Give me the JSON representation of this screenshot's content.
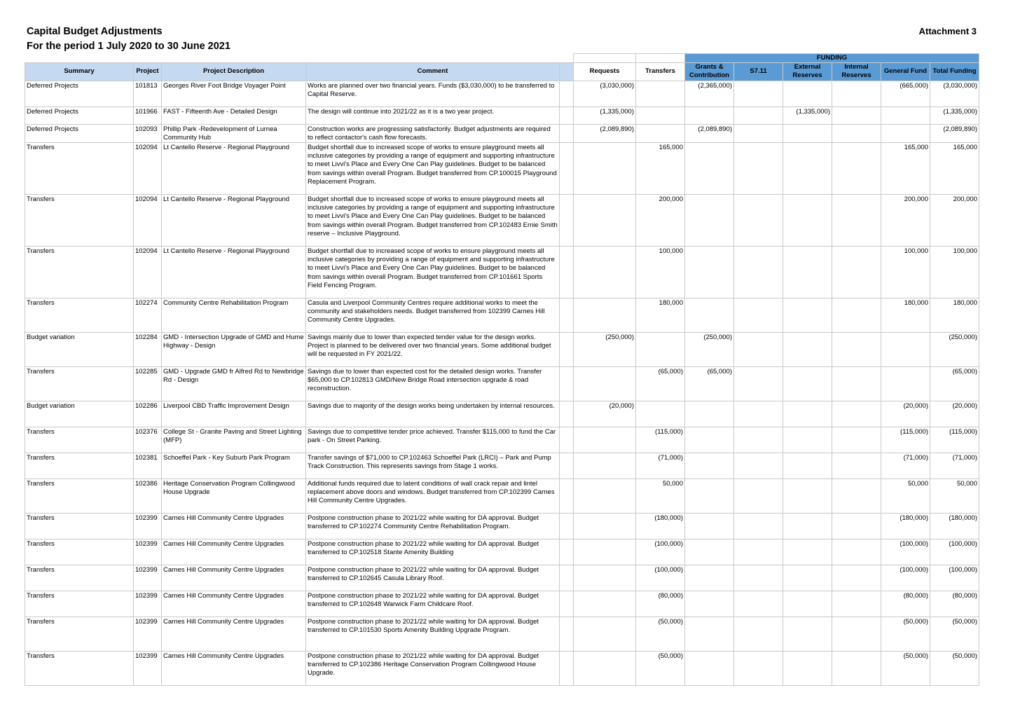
{
  "header": {
    "title": "Capital Budget Adjustments",
    "period": "For the period 1 July 2020 to 30 June 2021",
    "attachment": "Attachment 3"
  },
  "columns": {
    "summary": "Summary",
    "project": "Project",
    "description": "Project Description",
    "comment": "Comment",
    "requests": "Requests",
    "transfers": "Transfers",
    "funding": "FUNDING",
    "grants": "Grants & Contribution",
    "s711": "S7.11",
    "external": "External Reserves",
    "internal": "Internal Reserves",
    "general": "General Fund",
    "total": "Total Funding"
  },
  "rows": [
    {
      "summary": "Deferred Projects",
      "project": "101813",
      "description": "Georges River Foot Bridge Voyager Point",
      "comment": "Works are planned over two financial years. Funds ($3,030,000) to be transferred to Capital Reserve.",
      "requests": "(3,030,000)",
      "transfers": "",
      "grants": "(2,365,000)",
      "s711": "",
      "external": "",
      "internal": "",
      "general": "(665,000)",
      "total": "(3,030,000)",
      "h": 37
    },
    {
      "summary": "Deferred Projects",
      "project": "101966",
      "description": "FAST - Fifteenth Ave - Detailed Design",
      "comment": "The design will continue into 2021/22 as it is a two year project.",
      "requests": "(1,335,000)",
      "transfers": "",
      "grants": "",
      "s711": "",
      "external": "(1,335,000)",
      "internal": "",
      "general": "",
      "total": "(1,335,000)",
      "h": 25
    },
    {
      "summary": "Deferred Projects",
      "project": "102093",
      "description": "Phillip Park -Redevelopment of Lurnea Community Hub",
      "comment": "Construction works are progressing satisfactorily. Budget adjustments are required to reflect contactor's cash flow forecasts.",
      "requests": "(2,089,890)",
      "transfers": "",
      "grants": "(2,089,890)",
      "s711": "",
      "external": "",
      "internal": "",
      "general": "",
      "total": "(2,089,890)",
      "h": 26
    },
    {
      "summary": "Transfers",
      "project": "102094",
      "description": "Lt Cantello Reserve - Regional Playground",
      "comment": "Budget shortfall due to increased scope of works to ensure playground meets all inclusive categories by providing a range of equipment and supporting infrastructure to meet Livvi's Place and Every One Can Play guidelines.  Budget to be balanced from savings within overall Program.  Budget transferred from CP.100015 Playground Replacement Program.",
      "requests": "",
      "transfers": "165,000",
      "grants": "",
      "s711": "",
      "external": "",
      "internal": "",
      "general": "165,000",
      "total": "165,000",
      "h": 74
    },
    {
      "summary": "Transfers",
      "project": "102094",
      "description": "Lt Cantello Reserve - Regional Playground",
      "comment": "Budget shortfall due to increased scope of works to ensure playground meets all inclusive categories by providing a range of equipment and supporting infrastructure to meet Livvi's Place and Every One Can Play guidelines.  Budget to be balanced from savings within overall Program.  Budget transferred from CP.102483 Ernie Smith reserve – Inclusive Playground.",
      "requests": "",
      "transfers": "200,000",
      "grants": "",
      "s711": "",
      "external": "",
      "internal": "",
      "general": "200,000",
      "total": "200,000",
      "h": 74
    },
    {
      "summary": "Transfers",
      "project": "102094",
      "description": "Lt Cantello Reserve - Regional Playground",
      "comment": "Budget shortfall due to increased scope of works to ensure playground meets all inclusive categories by providing a range of equipment and supporting infrastructure to meet Livvi's Place and Every One Can Play guidelines.  Budget to be balanced from savings within overall Program.  Budget transferred from CP.101661 Sports Field Fencing Program.",
      "requests": "",
      "transfers": "100,000",
      "grants": "",
      "s711": "",
      "external": "",
      "internal": "",
      "general": "100,000",
      "total": "100,000",
      "h": 74
    },
    {
      "summary": "Transfers",
      "project": "102274",
      "description": "Community Centre Rehabilitation Program",
      "comment": "Casula and Liverpool Community Centres require additional works to meet the community and stakeholders needs.  Budget transferred from 102399 Carnes Hill Community Centre Upgrades.",
      "requests": "",
      "transfers": "180,000",
      "grants": "",
      "s711": "",
      "external": "",
      "internal": "",
      "general": "180,000",
      "total": "180,000",
      "h": 49
    },
    {
      "summary": "Budget variation",
      "project": "102284",
      "description": "GMD - Intersection Upgrade of GMD and Hume Highway - Design",
      "comment": "Savings mainly due to lower than expected tender value for the design works. Project is planned to be delivered over two financial years. Some additional budget will be requested in FY 2021/22.",
      "requests": "(250,000)",
      "transfers": "",
      "grants": "(250,000)",
      "s711": "",
      "external": "",
      "internal": "",
      "general": "",
      "total": "(250,000)",
      "h": 49
    },
    {
      "summary": "Transfers",
      "project": "102285",
      "description": "GMD - Upgrade GMD fr Alfred Rd to Newbridge Rd - Design",
      "comment": "Savings due to lower than expected cost for the detailed design works. Transfer $65,000 to CP.102813 GMD/New Bridge Road intersection upgrade & road reconstruction.",
      "requests": "",
      "transfers": "(65,000)",
      "grants": "(65,000)",
      "s711": "",
      "external": "",
      "internal": "",
      "general": "",
      "total": "(65,000)",
      "h": 49
    },
    {
      "summary": "Budget variation",
      "project": "102286",
      "description": "Liverpool CBD Traffic Improvement Design",
      "comment": "Savings due to majority of the design works being undertaken by internal resources.",
      "requests": "(20,000)",
      "transfers": "",
      "grants": "",
      "s711": "",
      "external": "",
      "internal": "",
      "general": "(20,000)",
      "total": "(20,000)",
      "h": 37
    },
    {
      "summary": "Transfers",
      "project": "102376",
      "description": "College St - Granite Paving and Street Lighting (MFP)",
      "comment": "Savings due to competitive tender price achieved. Transfer $115,000 to fund the Car park - On Street Parking.",
      "requests": "",
      "transfers": "(115,000)",
      "grants": "",
      "s711": "",
      "external": "",
      "internal": "",
      "general": "(115,000)",
      "total": "(115,000)",
      "h": 37
    },
    {
      "summary": "Transfers",
      "project": "102381",
      "description": "Schoeffel Park - Key Suburb Park Program",
      "comment": "Transfer savings of $71,000 to CP.102463 Schoeffel Park (LRCI) – Park and Pump Track Construction. This represents savings from Stage 1 works.",
      "requests": "",
      "transfers": "(71,000)",
      "grants": "",
      "s711": "",
      "external": "",
      "internal": "",
      "general": "(71,000)",
      "total": "(71,000)",
      "h": 37
    },
    {
      "summary": "Transfers",
      "project": "102386",
      "description": "Heritage Conservation Program Collingwood House Upgrade",
      "comment": "Additional funds required due to latent conditions of wall crack repair and lintel replacement above doors and windows.  Budget transferred from CP.102399 Carnes Hill Community Centre Upgrades.",
      "requests": "",
      "transfers": "50,000",
      "grants": "",
      "s711": "",
      "external": "",
      "internal": "",
      "general": "50,000",
      "total": "50,000",
      "h": 49
    },
    {
      "summary": "Transfers",
      "project": "102399",
      "description": "Carnes Hill Community Centre Upgrades",
      "comment": "Postpone construction phase to 2021/22 while waiting for DA approval.  Budget transferred to CP.102274 Community Centre Rehabilitation Program.",
      "requests": "",
      "transfers": "(180,000)",
      "grants": "",
      "s711": "",
      "external": "",
      "internal": "",
      "general": "(180,000)",
      "total": "(180,000)",
      "h": 37
    },
    {
      "summary": "Transfers",
      "project": "102399",
      "description": "Carnes Hill Community Centre Upgrades",
      "comment": "Postpone construction phase to 2021/22 while waiting for DA approval.  Budget transferred to CP.102518 Stante Amenity Building",
      "requests": "",
      "transfers": "(100,000)",
      "grants": "",
      "s711": "",
      "external": "",
      "internal": "",
      "general": "(100,000)",
      "total": "(100,000)",
      "h": 37
    },
    {
      "summary": "Transfers",
      "project": "102399",
      "description": "Carnes Hill Community Centre Upgrades",
      "comment": "Postpone construction phase to 2021/22 while waiting for DA approval.  Budget transferred to CP.102645 Casula Library Roof.",
      "requests": "",
      "transfers": "(100,000)",
      "grants": "",
      "s711": "",
      "external": "",
      "internal": "",
      "general": "(100,000)",
      "total": "(100,000)",
      "h": 37
    },
    {
      "summary": "Transfers",
      "project": "102399",
      "description": "Carnes Hill Community Centre Upgrades",
      "comment": "Postpone construction phase to 2021/22 while waiting for DA approval.  Budget transferred to CP.102648 Warwick Farm Childcare Roof.",
      "requests": "",
      "transfers": "(80,000)",
      "grants": "",
      "s711": "",
      "external": "",
      "internal": "",
      "general": "(80,000)",
      "total": "(80,000)",
      "h": 37
    },
    {
      "summary": "Transfers",
      "project": "102399",
      "description": "Carnes Hill Community Centre Upgrades",
      "comment": "Postpone construction phase to 2021/22 while waiting for DA approval.  Budget transferred to CP.101530 Sports Amenity Building Upgrade Program.",
      "requests": "",
      "transfers": "(50,000)",
      "grants": "",
      "s711": "",
      "external": "",
      "internal": "",
      "general": "(50,000)",
      "total": "(50,000)",
      "h": 49
    },
    {
      "summary": "Transfers",
      "project": "102399",
      "description": "Carnes Hill Community Centre Upgrades",
      "comment": "Postpone construction phase to 2021/22 while waiting for DA approval.  Budget transferred to CP.102386 Heritage Conservation Program Collingwood House Upgrade.",
      "requests": "",
      "transfers": "(50,000)",
      "grants": "",
      "s711": "",
      "external": "",
      "internal": "",
      "general": "(50,000)",
      "total": "(50,000)",
      "h": 49
    }
  ]
}
